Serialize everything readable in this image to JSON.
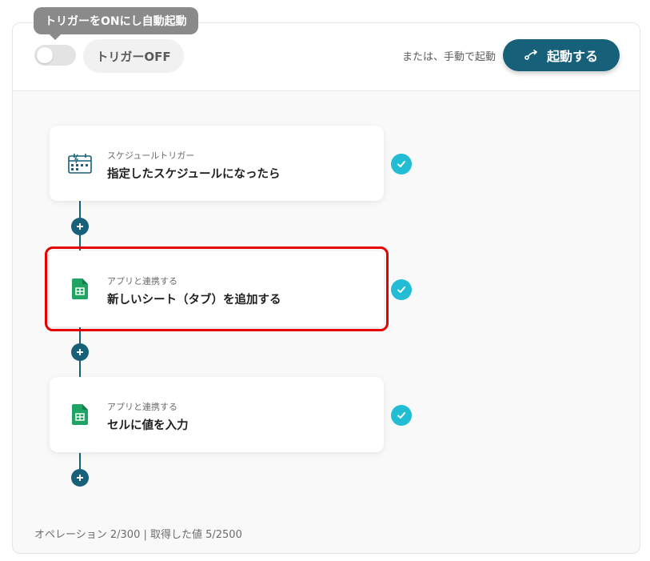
{
  "tooltip": {
    "text": "トリガーをONにし自動起動"
  },
  "trigger": {
    "toggle_state": "off",
    "label": "トリガーOFF"
  },
  "header": {
    "manual_text": "または、手動で起動",
    "start_label": "起動する",
    "start_icon": "share-arrow-icon"
  },
  "steps": [
    {
      "category": "スケジュールトリガー",
      "title": "指定したスケジュールになったら",
      "icon": "calendar-clock-icon",
      "status": "complete",
      "selected": false
    },
    {
      "category": "アプリと連携する",
      "title": "新しいシート（タブ）を追加する",
      "icon": "google-sheets-icon",
      "status": "complete",
      "selected": true
    },
    {
      "category": "アプリと連携する",
      "title": "セルに値を入力",
      "icon": "google-sheets-icon",
      "status": "complete",
      "selected": false
    }
  ],
  "footer": {
    "text": "オペレーション 2/300 | 取得した値 5/2500"
  },
  "colors": {
    "primary": "#17607a",
    "check": "#22bdd4",
    "selection": "#e60000",
    "sheets_green": "#1fa463"
  }
}
